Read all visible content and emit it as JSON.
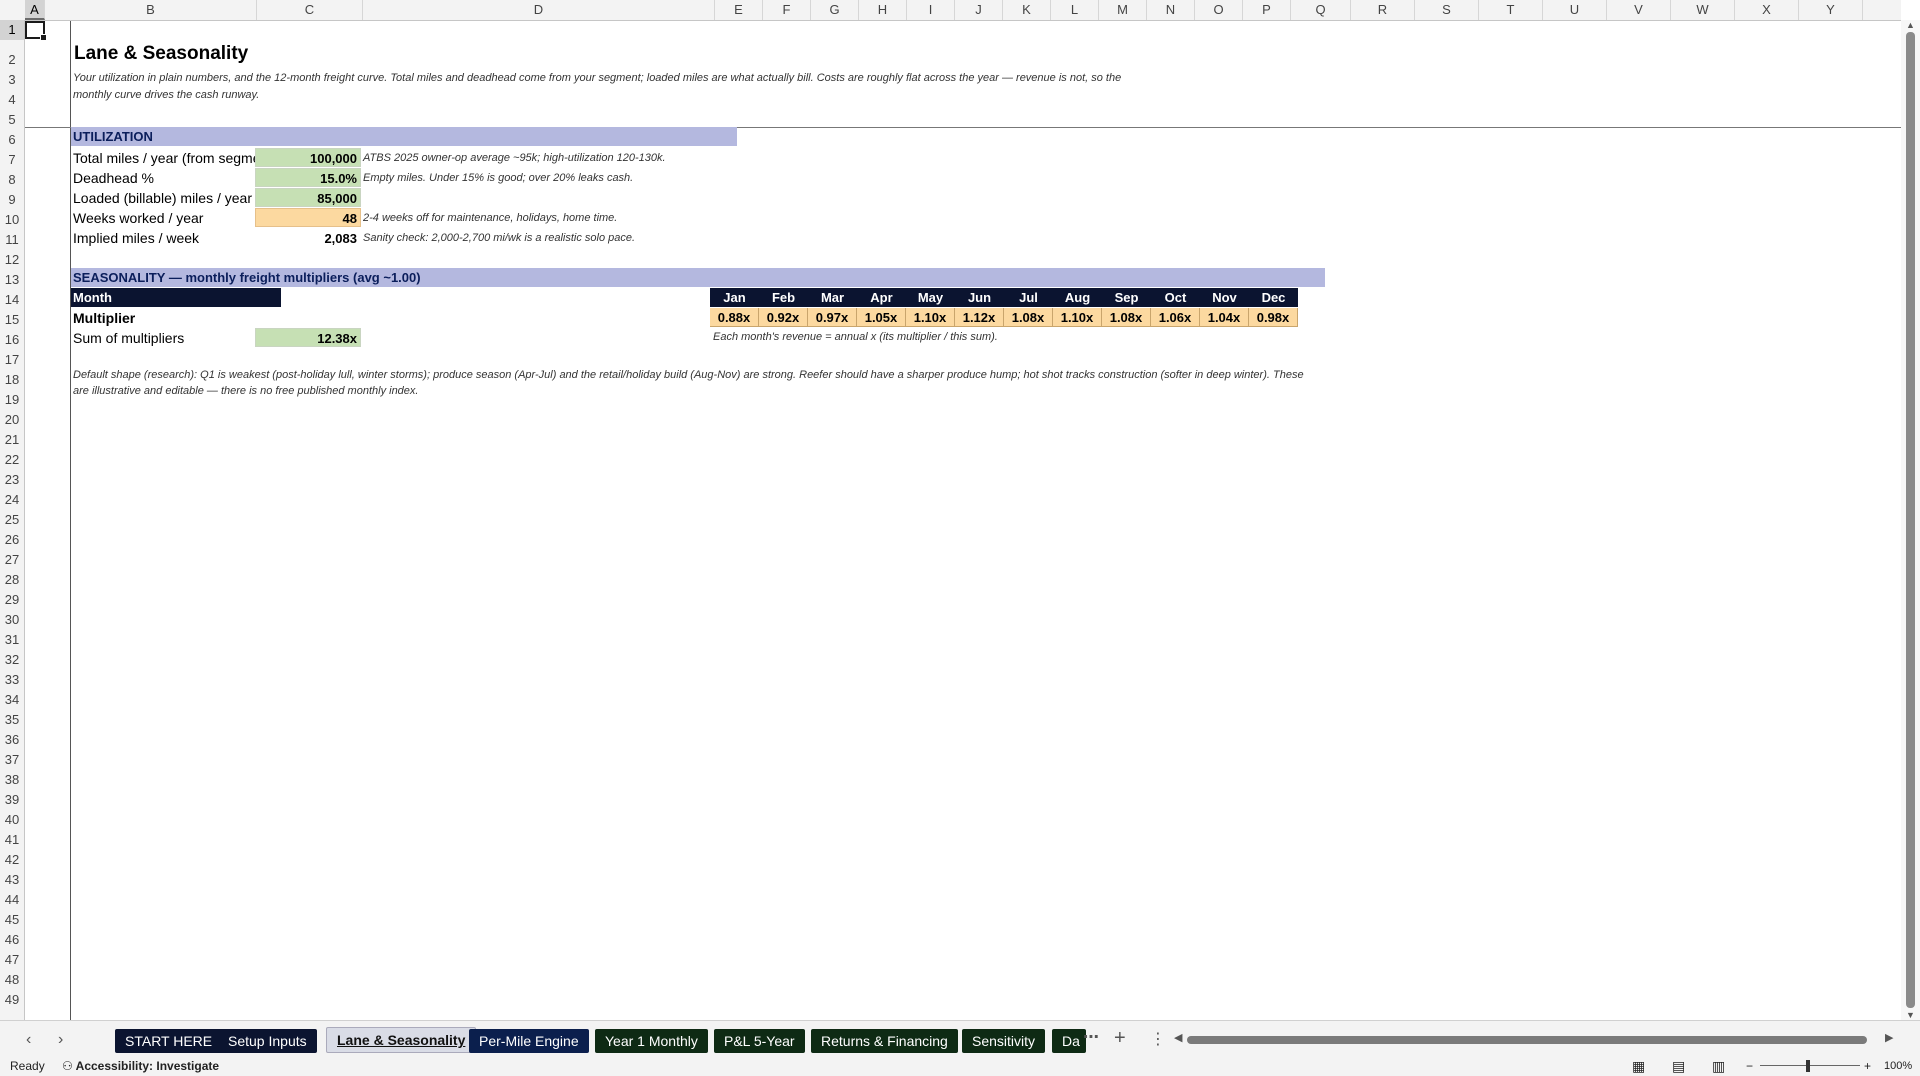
{
  "columns": [
    "A",
    "B",
    "C",
    "D",
    "E",
    "F",
    "G",
    "H",
    "I",
    "J",
    "K",
    "L",
    "M",
    "N",
    "O",
    "P",
    "Q",
    "R",
    "S",
    "T",
    "U",
    "V",
    "W",
    "X",
    "Y"
  ],
  "sheet": {
    "title": "Lane & Seasonality",
    "subtitle_line1": "Your utilization in plain numbers, and the 12-month freight curve. Total miles and deadhead come from your segment; loaded miles are what actually bill. Costs are roughly flat across the year — revenue is not, so the",
    "subtitle_line2": "monthly curve drives the cash runway.",
    "utilization": {
      "header": "UTILIZATION",
      "rows": [
        {
          "label": "Total miles / year (from segment)",
          "value": "100,000",
          "note": "ATBS 2025 owner-op average ~95k; high-utilization 120-130k."
        },
        {
          "label": "Deadhead %",
          "value": "15.0%",
          "note": "Empty miles. Under 15% is good; over 20% leaks cash."
        },
        {
          "label": "Loaded (billable) miles / year",
          "value": "85,000",
          "note": ""
        },
        {
          "label": "Weeks worked / year",
          "value": "48",
          "note": "2-4 weeks off for maintenance, holidays, home time."
        },
        {
          "label": "Implied miles / week",
          "value": "2,083",
          "note": "Sanity check: 2,000-2,700 mi/wk is a realistic solo pace."
        }
      ]
    },
    "seasonality": {
      "header": "SEASONALITY — monthly freight multipliers (avg ~1.00)",
      "month_label": "Month",
      "multiplier_label": "Multiplier",
      "sum_label": "Sum of multipliers",
      "sum_value": "12.38x",
      "months": [
        "Jan",
        "Feb",
        "Mar",
        "Apr",
        "May",
        "Jun",
        "Jul",
        "Aug",
        "Sep",
        "Oct",
        "Nov",
        "Dec"
      ],
      "multipliers": [
        "0.88x",
        "0.92x",
        "0.97x",
        "1.05x",
        "1.10x",
        "1.12x",
        "1.08x",
        "1.10x",
        "1.08x",
        "1.06x",
        "1.04x",
        "0.98x"
      ],
      "revenue_note": "Each month's revenue = annual x (its multiplier / this sum).",
      "default_note_line1": "Default shape (research): Q1 is weakest (post-holiday lull, winter storms); produce season (Apr-Jul) and the retail/holiday build (Aug-Nov) are strong. Reefer should have a sharper produce hump; hot shot tracks construction (softer in deep winter). These",
      "default_note_line2": "are illustrative and editable — there is no free published monthly index."
    }
  },
  "tabs": [
    {
      "label": "START HERE",
      "color": "#0b1430"
    },
    {
      "label": "Setup Inputs",
      "color": "#0b1430"
    },
    {
      "label": "Lane & Seasonality",
      "color": "#d9dce6"
    },
    {
      "label": "Per-Mile Engine",
      "color": "#0b1f4d"
    },
    {
      "label": "Year 1 Monthly",
      "color": "#0e2a14"
    },
    {
      "label": "P&L 5-Year",
      "color": "#0e2a14"
    },
    {
      "label": "Returns & Financing",
      "color": "#0e2a14"
    },
    {
      "label": "Sensitivity",
      "color": "#0e2a14"
    },
    {
      "label": "Da",
      "color": "#0e2a14"
    }
  ],
  "status": {
    "ready": "Ready",
    "accessibility": "Accessibility: Investigate",
    "zoom": "100%"
  }
}
